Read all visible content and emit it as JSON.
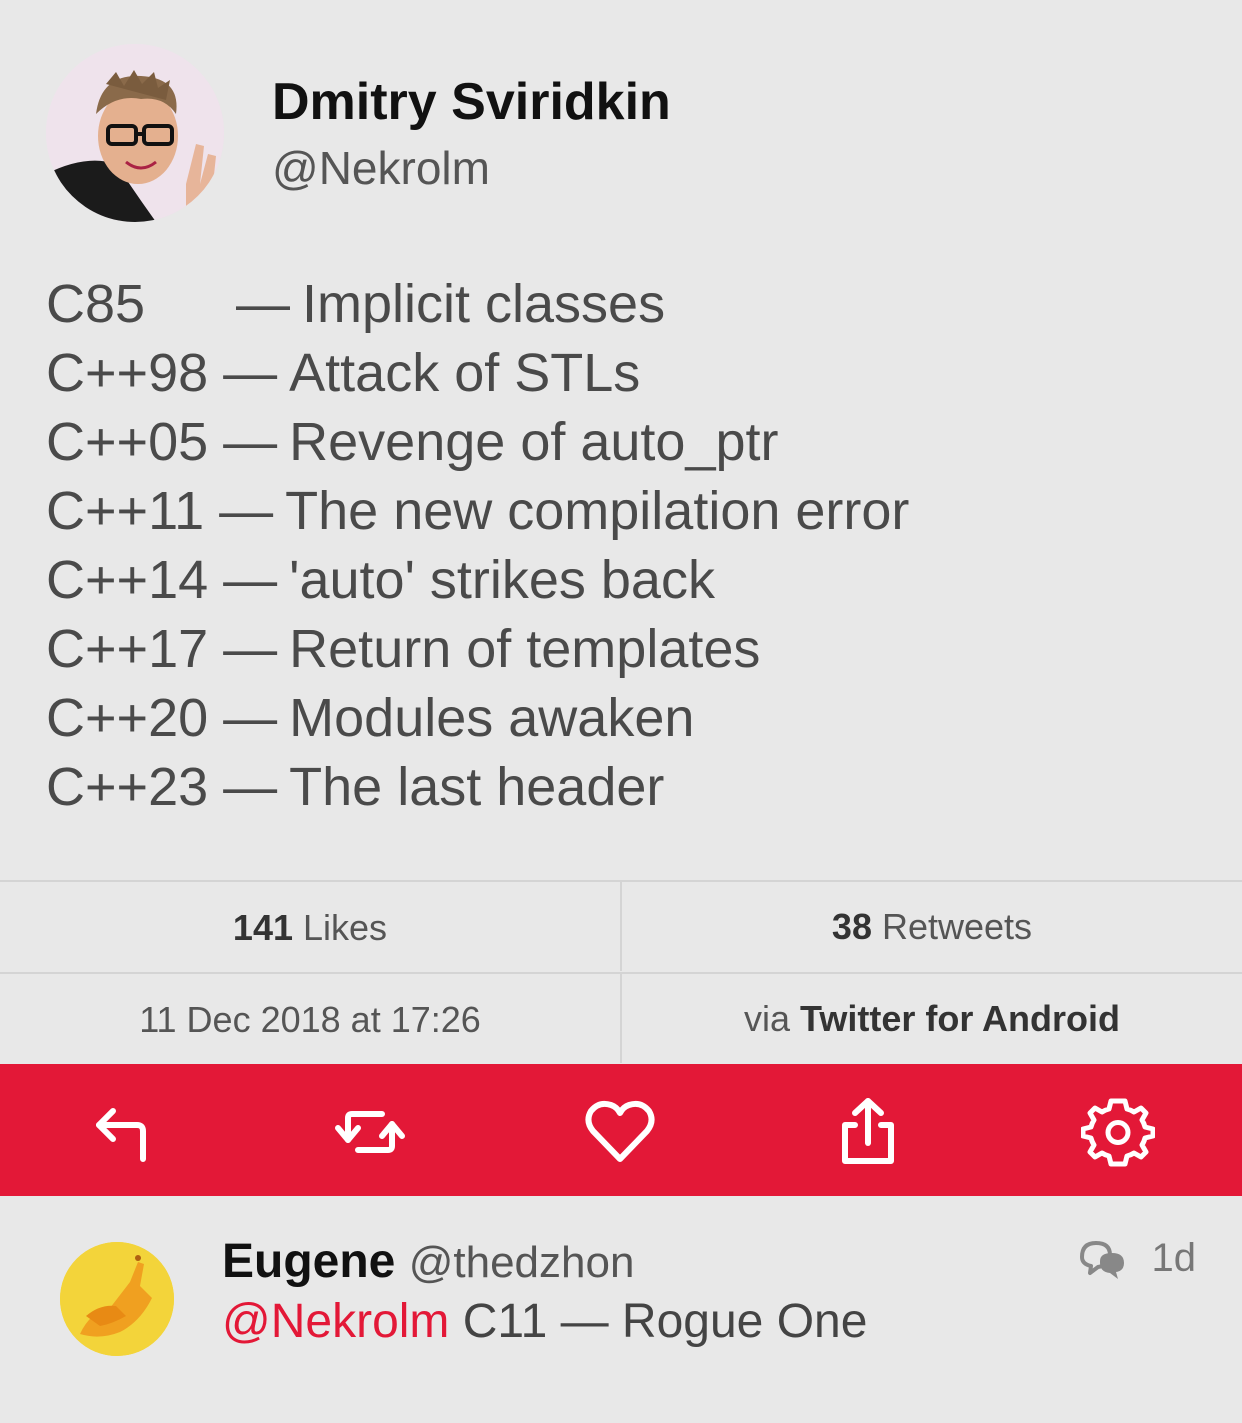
{
  "author": {
    "name": "Dmitry Sviridkin",
    "handle": "@Nekrolm"
  },
  "tweet": {
    "lines": [
      {
        "version": "C85",
        "dash": "—",
        "text": "Implicit classes"
      },
      {
        "version": "C++98",
        "dash": "—",
        "text": "Attack of STLs"
      },
      {
        "version": "C++05",
        "dash": "—",
        "text": "Revenge of auto_ptr"
      },
      {
        "version": "C++11",
        "dash": "—",
        "text": "The new compilation error"
      },
      {
        "version": "C++14",
        "dash": "—",
        "text": "'auto' strikes back"
      },
      {
        "version": "C++17",
        "dash": "—",
        "text": "Return of templates"
      },
      {
        "version": "C++20",
        "dash": "—",
        "text": "Modules awaken"
      },
      {
        "version": "C++23",
        "dash": "—",
        "text": "The last header"
      }
    ]
  },
  "stats": {
    "likes_count": "141",
    "likes_label": "Likes",
    "retweets_count": "38",
    "retweets_label": "Retweets",
    "date": "11 Dec 2018 at 17:26",
    "via_prefix": "via",
    "via_app": "Twitter for Android"
  },
  "actions": [
    {
      "name": "reply-icon"
    },
    {
      "name": "retweet-icon"
    },
    {
      "name": "like-heart-icon"
    },
    {
      "name": "share-icon"
    },
    {
      "name": "settings-gear-icon"
    }
  ],
  "reply": {
    "name": "Eugene",
    "handle": "@thedzhon",
    "mention": "@Nekrolm",
    "text": "C11 — Rogue One",
    "time": "1d"
  },
  "colors": {
    "accent": "#e31837",
    "background": "#e8e8e8"
  }
}
